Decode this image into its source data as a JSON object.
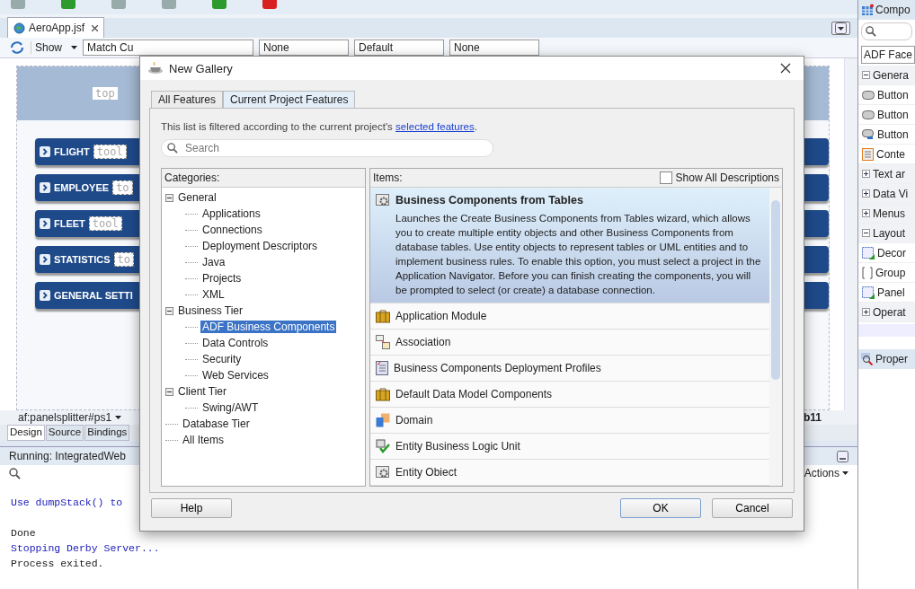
{
  "editor": {
    "tab": "AeroApp.jsf",
    "toolbar": {
      "show": "Show",
      "resolution": "Match Cu",
      "dropdowns": [
        "None",
        "Default",
        "None"
      ]
    },
    "canvas": {
      "top_label": "top",
      "menu_items": [
        {
          "label": "FLIGHT",
          "tag": "tool"
        },
        {
          "label": "EMPLOYEE",
          "tag": "to"
        },
        {
          "label": "FLEET",
          "tag": "tool"
        },
        {
          "label": "STATISTICS",
          "tag": "to"
        },
        {
          "label": "GENERAL SETTI"
        }
      ]
    },
    "breadcrumb": "af:panelsplitter#ps1",
    "breadcrumb_end": "b11",
    "view_tabs": [
      {
        "label": "Design",
        "selected": true
      },
      {
        "label": "Source",
        "selected": false
      },
      {
        "label": "Bindings",
        "selected": false
      }
    ]
  },
  "log": {
    "title": "Running: IntegratedWeb",
    "actions": "Actions",
    "blocks": [
      {
        "lines": [
          {
            "text": "Use dumpStack() to",
            "kind": "info"
          }
        ]
      },
      {
        "lines": [
          {
            "text": "Done",
            "kind": "plain"
          },
          {
            "text": "Stopping Derby Server...",
            "kind": "info"
          },
          {
            "text": "Process exited.",
            "kind": "plain"
          }
        ]
      }
    ]
  },
  "palette": {
    "title": "Compo",
    "library": "ADF Face",
    "rows": [
      {
        "label": "Genera",
        "kind": "section",
        "expanded": true
      },
      {
        "label": "Button",
        "kind": "button"
      },
      {
        "label": "Button",
        "kind": "button"
      },
      {
        "label": "Button",
        "kind": "link"
      },
      {
        "label": "Conte",
        "kind": "doc"
      },
      {
        "label": "Text ar",
        "kind": "section",
        "expanded": false
      },
      {
        "label": "Data Vi",
        "kind": "section",
        "expanded": false
      },
      {
        "label": "Menus",
        "kind": "section",
        "expanded": false
      },
      {
        "label": "Layout",
        "kind": "section",
        "expanded": true
      },
      {
        "label": "Decor",
        "kind": "panel"
      },
      {
        "label": "Group",
        "kind": "group"
      },
      {
        "label": "Panel",
        "kind": "panel"
      },
      {
        "label": "Operat",
        "kind": "section",
        "expanded": false
      }
    ],
    "properties": "Proper"
  },
  "dialog": {
    "title": "New Gallery",
    "tabs": [
      {
        "label": "All Features",
        "selected": false
      },
      {
        "label": "Current Project Features",
        "selected": true
      }
    ],
    "info": "This list is filtered according to the current project's",
    "info_link": "selected features",
    "info_end": ".",
    "search": {
      "placeholder": "Search"
    },
    "categories": {
      "heading": "Categories:",
      "tree": [
        {
          "label": "General",
          "expanded": true,
          "selected": false,
          "children": [
            {
              "label": "Applications",
              "selected": false
            },
            {
              "label": "Connections",
              "selected": false
            },
            {
              "label": "Deployment Descriptors",
              "selected": false
            },
            {
              "label": "Java",
              "selected": false
            },
            {
              "label": "Projects",
              "selected": false
            },
            {
              "label": "XML",
              "selected": false
            }
          ]
        },
        {
          "label": "Business Tier",
          "expanded": true,
          "selected": false,
          "children": [
            {
              "label": "ADF Business Components",
              "selected": true
            },
            {
              "label": "Data Controls",
              "selected": false
            },
            {
              "label": "Security",
              "selected": false
            },
            {
              "label": "Web Services",
              "selected": false
            }
          ]
        },
        {
          "label": "Client Tier",
          "expanded": true,
          "selected": false,
          "children": [
            {
              "label": "Swing/AWT",
              "selected": false
            }
          ]
        },
        {
          "label": "Database Tier",
          "selected": false
        },
        {
          "label": "All Items",
          "selected": false
        }
      ]
    },
    "items": {
      "heading": "Items:",
      "show_all": {
        "label": "Show All Descriptions",
        "checked": false
      },
      "list": [
        {
          "label": "Business Components from Tables",
          "kind": "gear",
          "selected": true,
          "description": "Launches the Create Business Components from Tables wizard, which allows you to create multiple entity objects and other Business Components from database tables. Use entity objects to represent tables or UML entities and to implement business rules. To enable this option, you must select a project in the Application Navigator. Before you can finish creating the components, you will be prompted to select (or create) a database connection."
        },
        {
          "label": "Application Module",
          "kind": "briefcase",
          "selected": false
        },
        {
          "label": "Association",
          "kind": "association",
          "selected": false
        },
        {
          "label": "Business Components Deployment Profiles",
          "kind": "profile",
          "selected": false
        },
        {
          "label": "Default Data Model Components",
          "kind": "briefcase",
          "selected": false
        },
        {
          "label": "Domain",
          "kind": "domain",
          "selected": false
        },
        {
          "label": "Entity Business Logic Unit",
          "kind": "check",
          "selected": false
        },
        {
          "label": "Entity Obiect",
          "kind": "gear",
          "selected": false
        }
      ]
    },
    "buttons": {
      "help": "Help",
      "ok": "OK",
      "cancel": "Cancel"
    }
  }
}
